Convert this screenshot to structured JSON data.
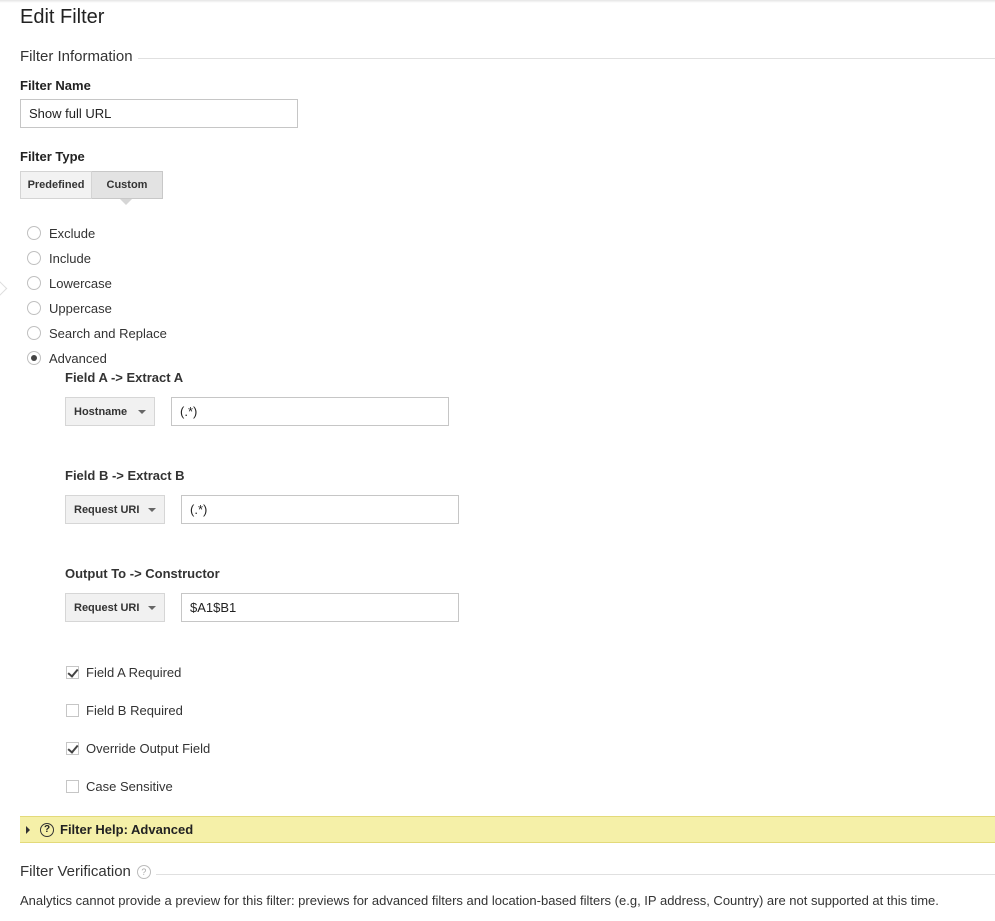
{
  "page": {
    "title": "Edit Filter"
  },
  "filter_information": {
    "heading": "Filter Information",
    "name_label": "Filter Name",
    "name_value": "Show full URL"
  },
  "filter_type": {
    "label": "Filter Type",
    "tabs": [
      "Predefined",
      "Custom"
    ],
    "selected_tab": "Custom",
    "options": [
      "Exclude",
      "Include",
      "Lowercase",
      "Uppercase",
      "Search and Replace",
      "Advanced"
    ],
    "selected_option": "Advanced"
  },
  "advanced": {
    "field_a": {
      "label": "Field A -> Extract A",
      "dropdown": "Hostname",
      "value": "(.*)"
    },
    "field_b": {
      "label": "Field B -> Extract B",
      "dropdown": "Request URI",
      "value": "(.*)"
    },
    "output": {
      "label": "Output To -> Constructor",
      "dropdown": "Request URI",
      "value": "$A1$B1"
    },
    "checkboxes": [
      {
        "label": "Field A Required",
        "checked": true
      },
      {
        "label": "Field B Required",
        "checked": false
      },
      {
        "label": "Override Output Field",
        "checked": true
      },
      {
        "label": "Case Sensitive",
        "checked": false
      }
    ]
  },
  "help": {
    "label": "Filter Help: Advanced",
    "icon": "question-icon",
    "color": "#f5f0a8"
  },
  "verification": {
    "heading": "Filter Verification",
    "note": "Analytics cannot provide a preview for this filter: previews for advanced filters and location-based filters (e.g, IP address, Country) are not supported at this time."
  }
}
